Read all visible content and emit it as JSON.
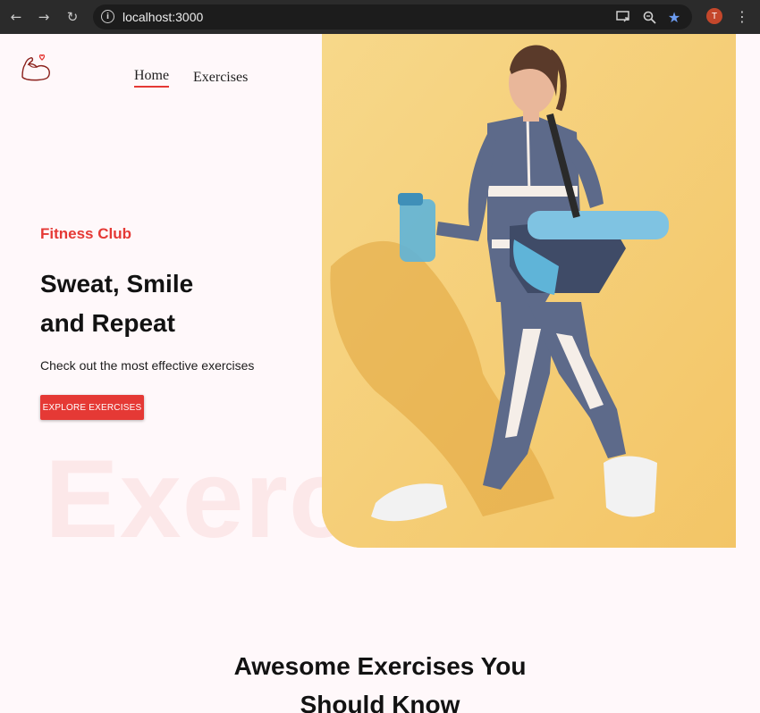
{
  "browser": {
    "url": "localhost:3000",
    "avatar_initial": "T"
  },
  "nav": {
    "home_label": "Home",
    "exercises_label": "Exercises"
  },
  "hero": {
    "club": "Fitness Club",
    "headline_line1": "Sweat, Smile",
    "headline_line2": "and Repeat",
    "subline": "Check out the most effective exercises",
    "cta_label": "EXPLORE EXERCISES",
    "background_word": "Exercise"
  },
  "section": {
    "title_line1": "Awesome Exercises You",
    "title_line2": "Should Know"
  },
  "colors": {
    "accent": "#e53935",
    "page_bg": "#fff8fa",
    "photo_bg": "#f6d37e"
  }
}
